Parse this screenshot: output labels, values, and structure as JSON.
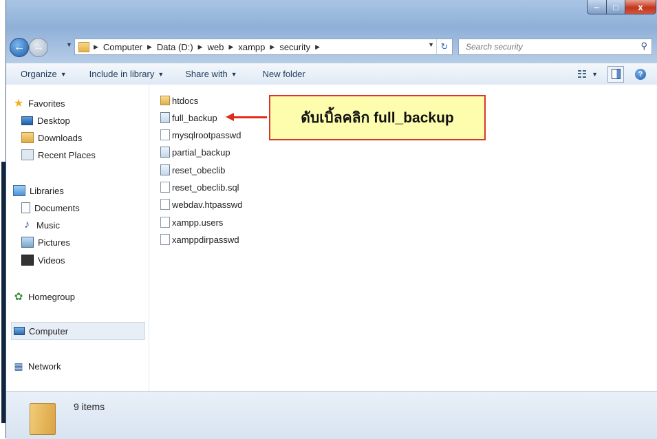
{
  "window": {
    "buttons": {
      "minimize": "‒",
      "maximize": "□",
      "close": "x"
    }
  },
  "address": {
    "crumbs": [
      "Computer",
      "Data (D:)",
      "web",
      "xampp",
      "security"
    ]
  },
  "search": {
    "placeholder": "Search security"
  },
  "toolbar": {
    "organize": "Organize",
    "include_in_library": "Include in library",
    "share_with": "Share with",
    "new_folder": "New folder"
  },
  "nav": {
    "favorites": "Favorites",
    "desktop": "Desktop",
    "downloads": "Downloads",
    "recent_places": "Recent Places",
    "libraries": "Libraries",
    "documents": "Documents",
    "music": "Music",
    "pictures": "Pictures",
    "videos": "Videos",
    "homegroup": "Homegroup",
    "computer": "Computer",
    "network": "Network"
  },
  "files": [
    {
      "name": "htdocs",
      "icon": "folder-icon"
    },
    {
      "name": "full_backup",
      "icon": "script-file-icon"
    },
    {
      "name": "mysqlrootpasswd",
      "icon": "file-icon"
    },
    {
      "name": "partial_backup",
      "icon": "script-file-icon"
    },
    {
      "name": "reset_obeclib",
      "icon": "script-file-icon"
    },
    {
      "name": "reset_obeclib.sql",
      "icon": "file-icon"
    },
    {
      "name": "webdav.htpasswd",
      "icon": "file-icon"
    },
    {
      "name": "xampp.users",
      "icon": "file-icon"
    },
    {
      "name": "xamppdirpasswd",
      "icon": "file-icon"
    }
  ],
  "callout": {
    "text": "ดับเบิ้ลคลิก full_backup"
  },
  "status": {
    "items": "9 items"
  },
  "colors": {
    "callout_bg": "#fdfdad",
    "callout_border": "#d9352c",
    "arrow": "#e02a1e"
  }
}
